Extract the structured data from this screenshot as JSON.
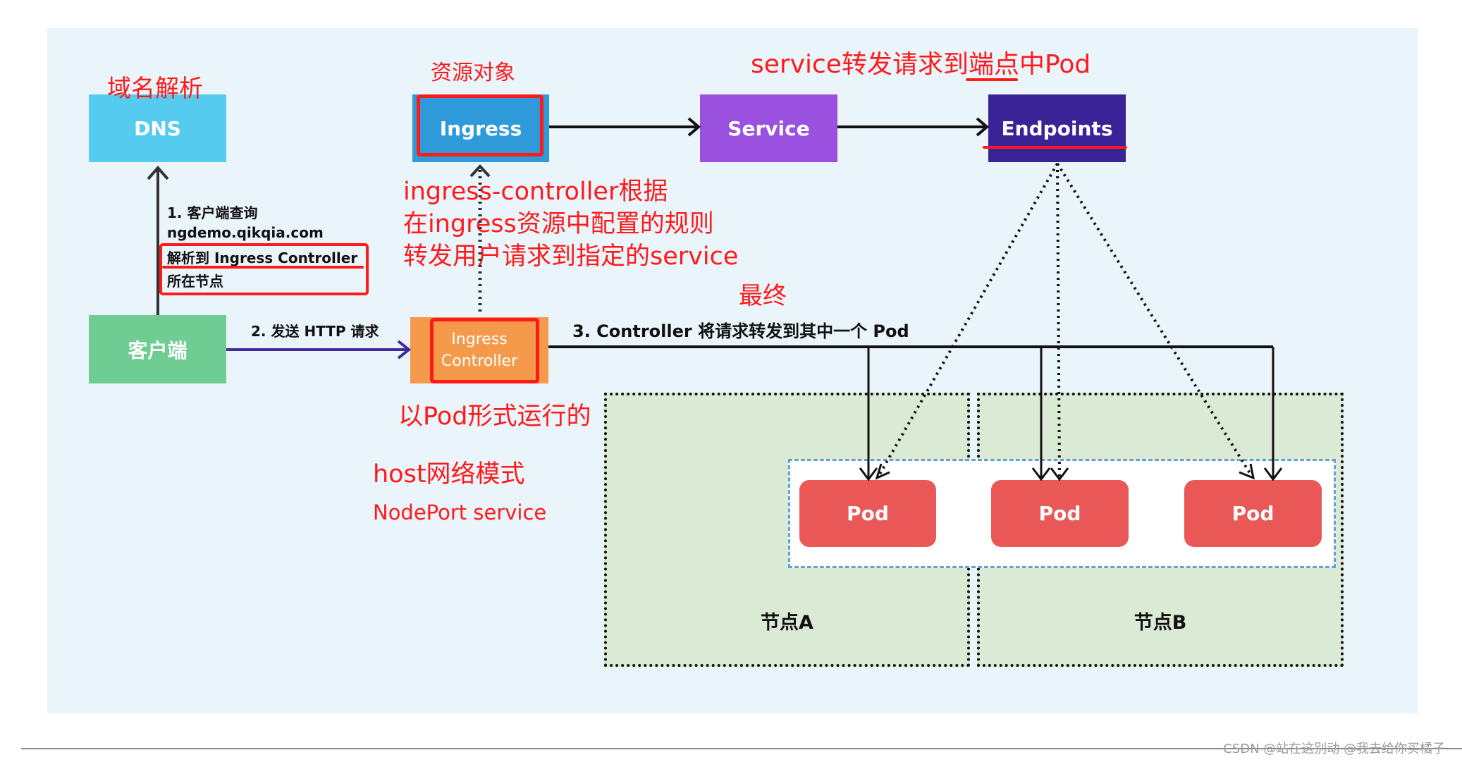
{
  "components": {
    "dns": "DNS",
    "ingress": "Ingress",
    "service": "Service",
    "endpoints": "Endpoints",
    "client": "客户端",
    "ingress_controller_line1": "Ingress",
    "ingress_controller_line2": "Controller",
    "pods": [
      "Pod",
      "Pod",
      "Pod"
    ],
    "node_a": "节点A",
    "node_b": "节点B"
  },
  "steps": {
    "step1_line1": "1. 客户端查询",
    "step1_line2": "ngdemo.qikqia.com",
    "step1_line3": "解析到 Ingress Controller",
    "step1_line4": "所在节点",
    "step2": "2. 发送 HTTP 请求",
    "step3": "3. Controller 将请求转发到其中一个 Pod"
  },
  "annotations": {
    "dns_note": "域名解析",
    "ingress_note": "资源对象",
    "service_note": "service转发请求到端点中Pod",
    "controller_rule_line1": "ingress-controller根据",
    "controller_rule_line2": "在ingress资源中配置的规则",
    "controller_rule_line3": "转发用户请求到指定的service",
    "final_note": "最终",
    "pod_form_note": "以Pod形式运行的",
    "host_mode_note": "host网络模式",
    "nodeport_note": "NodePort service"
  },
  "colors": {
    "dns": "#56cbf0",
    "ingress": "#2f9ad9",
    "service": "#9b51df",
    "endpoints": "#3a2396",
    "client": "#6fcd93",
    "ingress_controller": "#f49a4a",
    "pod": "#ea5757",
    "annotation": "#ff1a1a"
  },
  "footer": {
    "watermark": "CSDN @站在这别动 @我去给你买橘子"
  }
}
